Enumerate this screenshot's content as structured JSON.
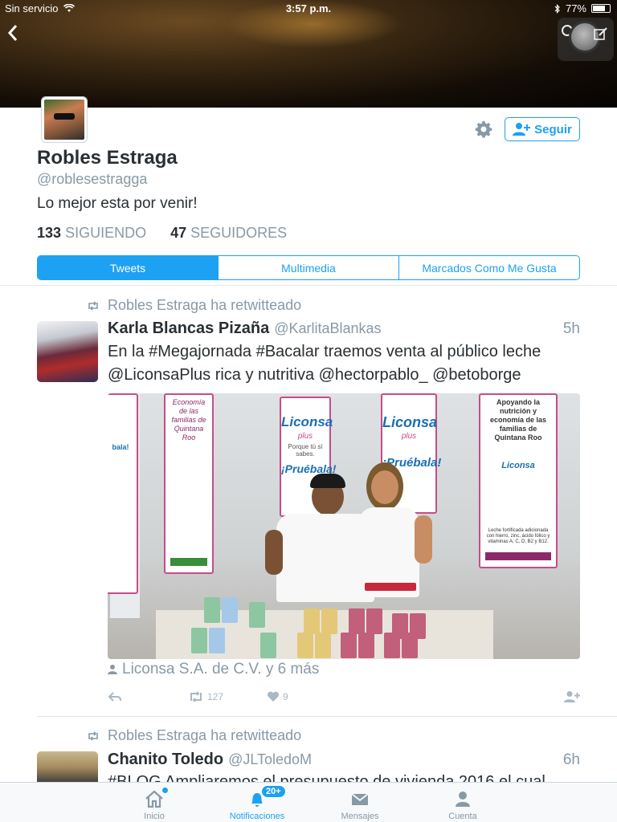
{
  "status_bar": {
    "carrier": "Sin servicio",
    "time": "3:57 p.m.",
    "battery": "77%",
    "battery_level": 0.77
  },
  "profile": {
    "name": "Robles Estraga",
    "handle": "@roblesestragga",
    "bio": "Lo mejor esta por venir!",
    "following_count": "133",
    "following_label": "SIGUIENDO",
    "followers_count": "47",
    "followers_label": "SEGUIDORES",
    "follow_button": "Seguir"
  },
  "tabs": [
    {
      "label": "Tweets",
      "active": true
    },
    {
      "label": "Multimedia",
      "active": false
    },
    {
      "label": "Marcados Como Me Gusta",
      "active": false
    }
  ],
  "tweets": [
    {
      "retweet_line": "Robles Estraga ha retwitteado",
      "author": "Karla Blancas Pizaña",
      "handle": "@KarlitaBlankas",
      "time": "5h",
      "text": "En la #Megajornada #Bacalar traemos venta al público leche @LiconsaPlus rica y nutritiva @hectorpablo_ @betoborge",
      "photo_signs": {
        "brand": "Liconsa",
        "brand_sub": "plus",
        "tagline": "Porque tú sí sabes.",
        "slogan": "¡Pruébala!",
        "right_sign": "Apoyando la nutrición y economía de las familias de Quintana Roo",
        "left_sign": "Economía de las familias de Quintana Roo",
        "right_small": "Leche fortificada adicionada con hierro, zinc, ácido fólico y vitaminas A, C, D, B2 y B12."
      },
      "mentions": "Liconsa S.A. de C.V. y 6 más",
      "retweets": "127",
      "likes": "9"
    },
    {
      "retweet_line": "Robles Estraga ha retwitteado",
      "author": "Chanito Toledo",
      "handle": "@JLToledoM",
      "time": "6h",
      "text": "#BLOG Ampliaremos el presupuesto de vivienda 2016 el cual"
    }
  ],
  "tab_bar": {
    "home": "Inicio",
    "notifications": "Notificaciones",
    "notifications_badge": "20+",
    "messages": "Mensajes",
    "account": "Cuenta"
  },
  "colors": {
    "accent": "#1da1f2",
    "muted": "#8899a6",
    "text": "#292f33"
  }
}
